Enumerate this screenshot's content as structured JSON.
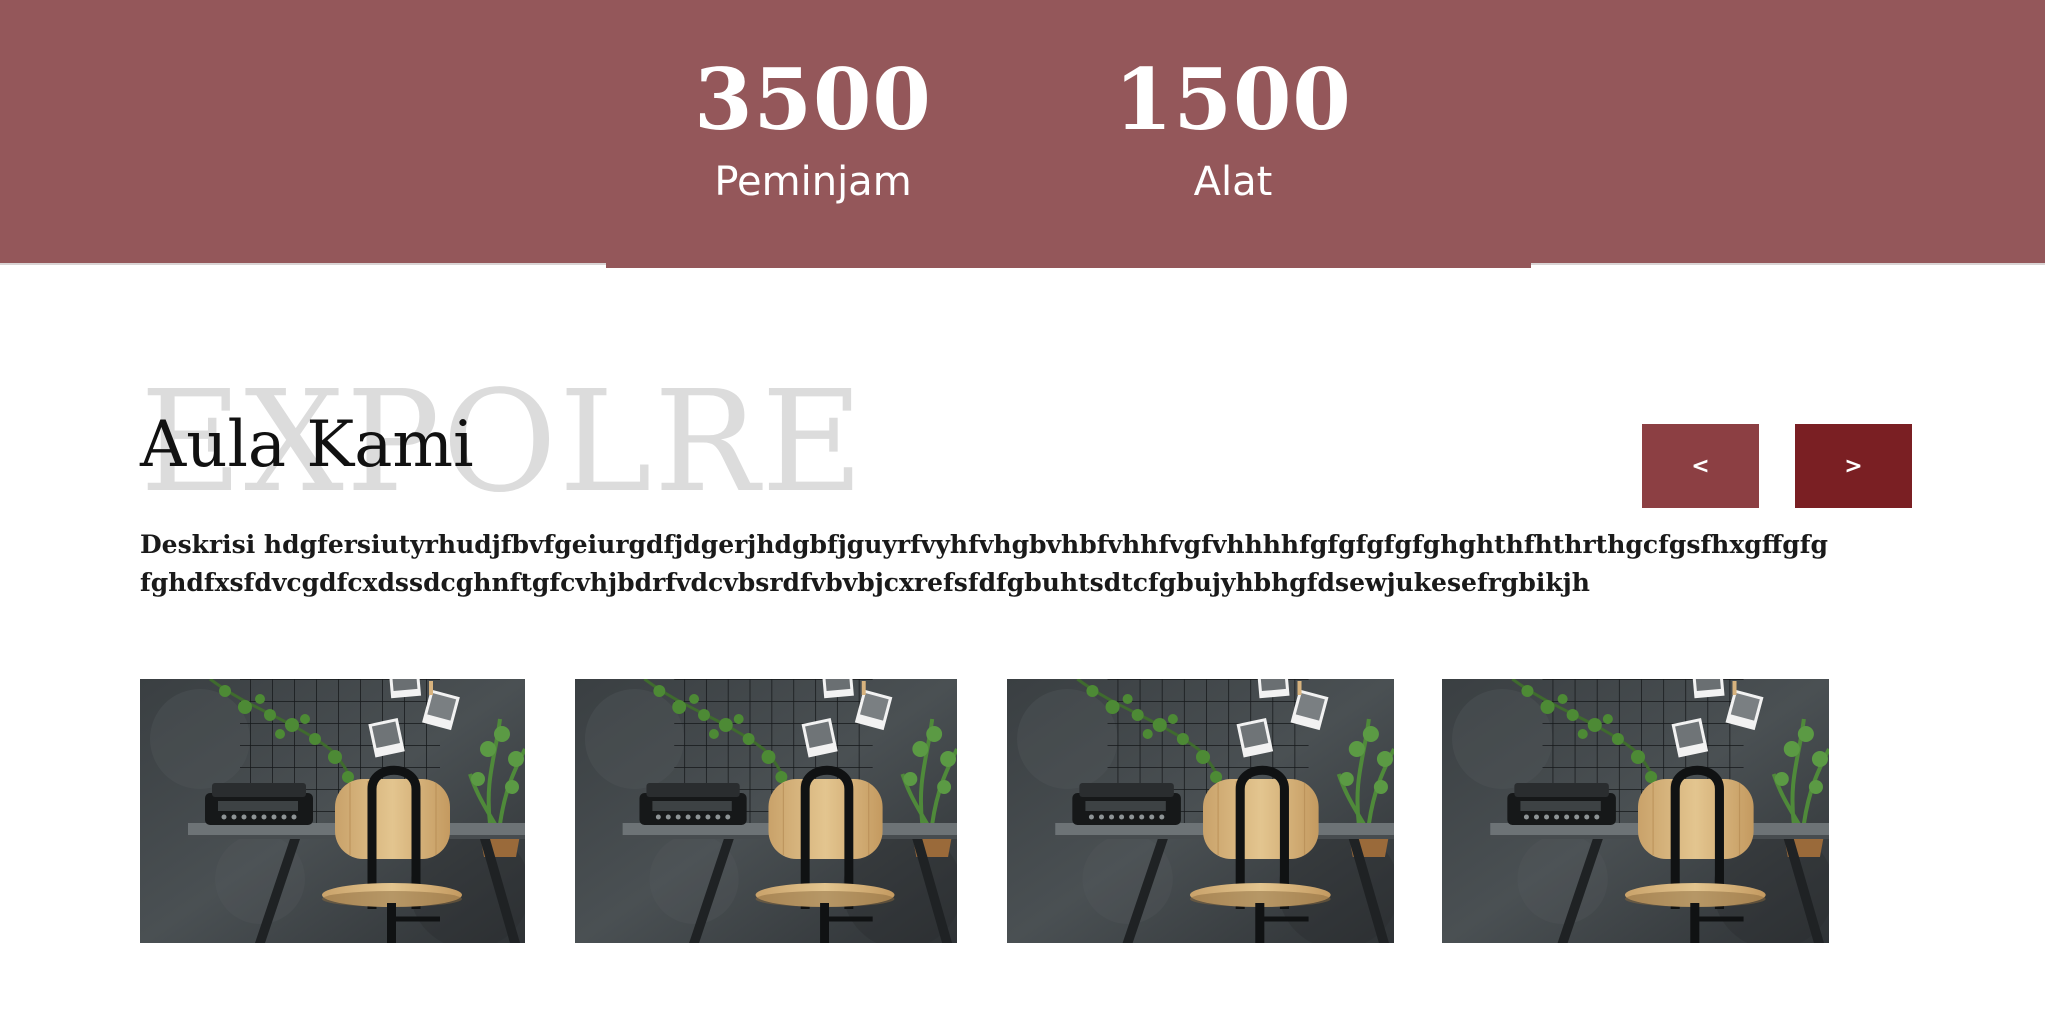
{
  "stats": [
    {
      "value": "3500",
      "label": "Peminjam"
    },
    {
      "value": "1500",
      "label": "Alat"
    }
  ],
  "section": {
    "watermark": "EXPOLRE",
    "title": "Aula Kami",
    "description_lines": [
      "Deskrisi hdgfersiutyrhudjfbvfgeiurgdfjdgerjhdgbfjguyrfvyhfvhgbvhbfvhhfvgfvhhhhfgfgfgfgfghghthfhthrthgcfgsfhxgffgfg",
      "fghdfxsfdvcgdfcxdssdcghnftgfcvhjbdrfvdcvbsrdfvbvbjcxrefsfdfgbuhtsdtcfgbujyhbhgfdsewjukesefrgbikjh"
    ]
  },
  "carousel": {
    "prev_label": "<",
    "next_label": ">"
  },
  "gallery": [
    {
      "icon": "desk-chair-photo"
    },
    {
      "icon": "desk-chair-photo"
    },
    {
      "icon": "desk-chair-photo"
    },
    {
      "icon": "desk-chair-photo"
    }
  ],
  "colors": {
    "banner": "#94575a",
    "prev_button": "#8c3f43",
    "next_button": "#7a1f23"
  }
}
